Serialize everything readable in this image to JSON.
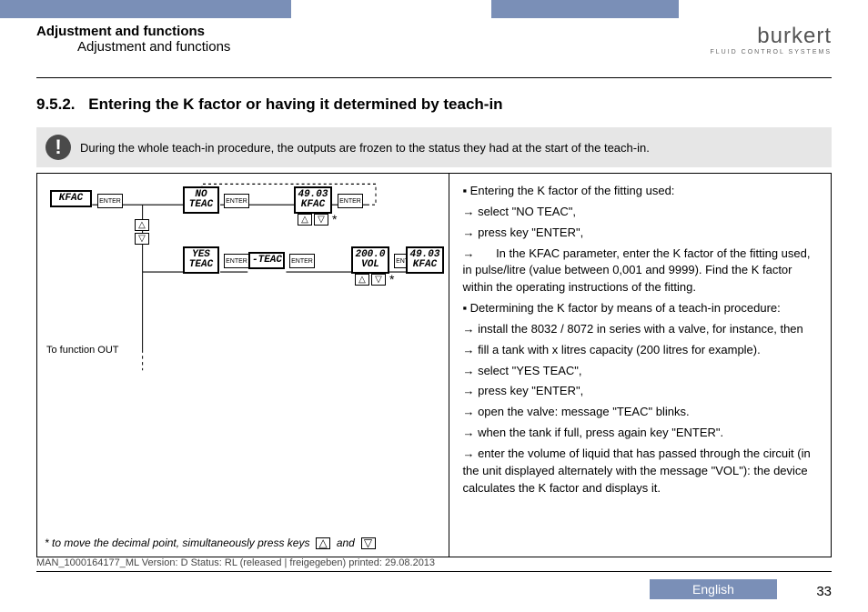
{
  "header": {
    "line1": "Adjustment and functions",
    "line2": "Adjustment and functions",
    "logo": "burkert",
    "logo_sub": "FLUID CONTROL SYSTEMS"
  },
  "section": {
    "number": "9.5.2.",
    "title": "Entering the K factor or having it determined by teach-in"
  },
  "info_text": "During the whole teach-in procedure, the outputs are frozen to the status they had at the start of the teach-in.",
  "diagram": {
    "kfac": "KFAC",
    "no_teac_top": "NO",
    "no_teac_bot": "TEAC",
    "yes_teac_top": "YES",
    "yes_teac_bot": "TEAC",
    "teac_only": "-TEAC",
    "val_4903_top": "49.03",
    "val_4903_bot": "KFAC",
    "vol_top": "200.0",
    "vol_bot": "VOL",
    "kfac2_top": "49.03",
    "kfac2_bot": "KFAC",
    "enter": "ENTER",
    "to_func": "To function OUT",
    "footnote_1": "* to move the decimal point, simultaneously press keys",
    "footnote_2": "and",
    "up": "△",
    "down": "▽",
    "star": "*"
  },
  "procedure": {
    "p1": "Entering the K factor of the fitting used:",
    "p2": "select \"NO TEAC\",",
    "p3": "press key \"ENTER\",",
    "p4": "In the KFAC parameter, enter the K factor of the fitting used, in pulse/litre (value between 0,001 and 9999). Find the K factor within the operating instructions of the fitting.",
    "p5": "Determining the K factor by means of a teach-in procedure:",
    "p6": "install the 8032 / 8072 in series with a valve, for instance, then",
    "p7": "fill a tank with x litres capacity (200 litres for example).",
    "p8": "select \"YES TEAC\",",
    "p9": "press key \"ENTER\",",
    "p10": "open the valve: message \"TEAC\" blinks.",
    "p11": "when the tank if full, press again key \"ENTER\".",
    "p12": "enter the volume of liquid that has passed through the circuit (in the unit displayed alternately with the message \"VOL\"): the device calculates the K factor and displays it."
  },
  "footer": {
    "doc_id": "MAN_1000164177_ML  Version: D Status: RL (released | freigegeben)  printed: 29.08.2013",
    "language": "English",
    "page": "33"
  }
}
